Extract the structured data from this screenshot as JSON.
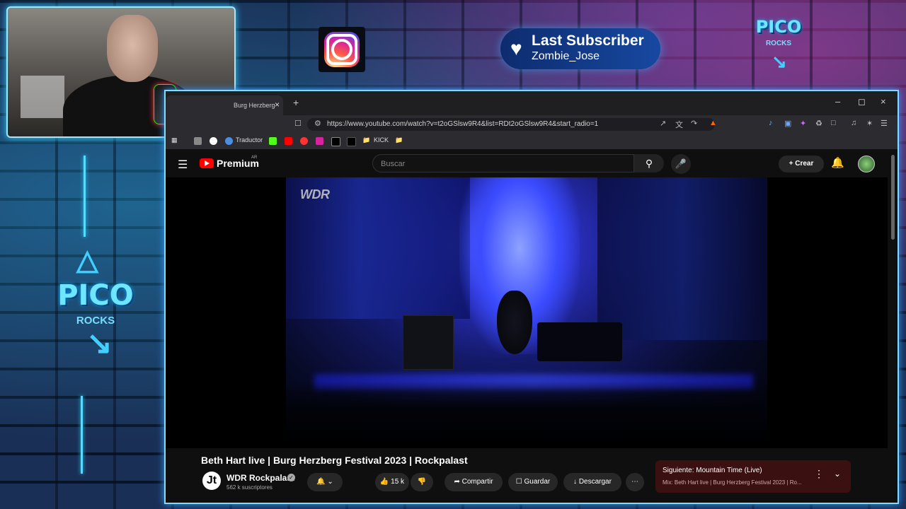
{
  "overlay": {
    "last_subscriber_label": "Last Subscriber",
    "last_subscriber_name": "Zombie_Jose",
    "logo_top": {
      "pico": "PICO",
      "rocks": "ROCKS"
    },
    "logo_side": {
      "pico": "PICO",
      "rocks": "ROCKS"
    }
  },
  "browser": {
    "tab_title": "Burg Herzberg",
    "url": "https://www.youtube.com/watch?v=t2oGSlsw9R4&list=RDt2oGSlsw9R4&start_radio=1",
    "bookmarks": [
      "Traductor",
      "KICK"
    ]
  },
  "youtube": {
    "brand": "Premium",
    "region": "AR",
    "search_placeholder": "Buscar",
    "create_label": "Crear",
    "video_watermark": "WDR",
    "video_title": "Beth Hart live | Burg Herzberg Festival 2023 | Rockpalast",
    "channel_name": "WDR Rockpalast",
    "channel_subs": "562 k suscriptores",
    "channel_icon_letter": "Jt",
    "likes": "15 k",
    "share_label": "Compartir",
    "save_label": "Guardar",
    "download_label": "Descargar",
    "next_label": "Siguiente: Mountain Time (Live)",
    "next_mix": "Mix: Beth Hart live | Burg Herzberg Festival 2023 | Ro..."
  }
}
